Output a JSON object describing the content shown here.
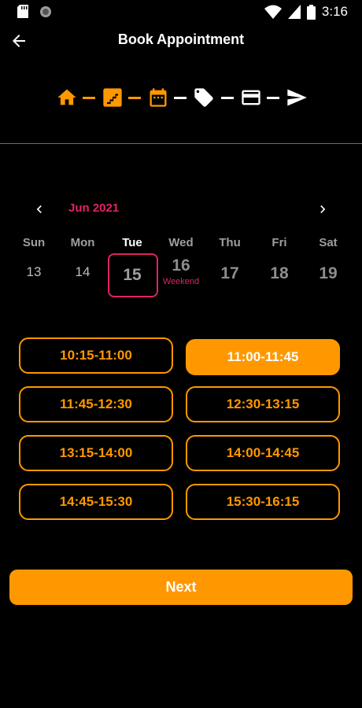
{
  "status_bar": {
    "time": "3:16",
    "icons": [
      "sd-card-icon",
      "circle-icon",
      "wifi-icon",
      "signal-icon",
      "battery-icon"
    ]
  },
  "app_bar": {
    "title": "Book Appointment",
    "back_icon": "arrow-left-icon"
  },
  "stepper": {
    "steps": [
      {
        "icon": "home-icon",
        "state": "done"
      },
      {
        "icon": "stairs-icon",
        "state": "done"
      },
      {
        "icon": "calendar-icon",
        "state": "current"
      },
      {
        "icon": "tag-icon",
        "state": "pending"
      },
      {
        "icon": "credit-card-icon",
        "state": "pending"
      },
      {
        "icon": "send-icon",
        "state": "pending"
      }
    ],
    "active_color": "#ff9800",
    "inactive_color": "#ffffff"
  },
  "calendar": {
    "month_label": "Jun 2021",
    "prev_icon": "chevron-left-icon",
    "next_icon": "chevron-right-icon",
    "days": [
      {
        "name": "Sun",
        "num": "13",
        "sub": ""
      },
      {
        "name": "Mon",
        "num": "14",
        "sub": ""
      },
      {
        "name": "Tue",
        "num": "15",
        "sub": ""
      },
      {
        "name": "Wed",
        "num": "16",
        "sub": "Weekend"
      },
      {
        "name": "Thu",
        "num": "17",
        "sub": ""
      },
      {
        "name": "Fri",
        "num": "18",
        "sub": ""
      },
      {
        "name": "Sat",
        "num": "19",
        "sub": ""
      }
    ],
    "selected_index": 2,
    "accent_color": "#e0245e"
  },
  "time_slots": [
    {
      "label": "10:15-11:00",
      "selected": false
    },
    {
      "label": "11:00-11:45",
      "selected": true
    },
    {
      "label": "11:45-12:30",
      "selected": false
    },
    {
      "label": "12:30-13:15",
      "selected": false
    },
    {
      "label": "13:15-14:00",
      "selected": false
    },
    {
      "label": "14:00-14:45",
      "selected": false
    },
    {
      "label": "14:45-15:30",
      "selected": false
    },
    {
      "label": "15:30-16:15",
      "selected": false
    }
  ],
  "next_button": {
    "label": "Next"
  },
  "colors": {
    "primary": "#ff9800",
    "background": "#000000"
  }
}
